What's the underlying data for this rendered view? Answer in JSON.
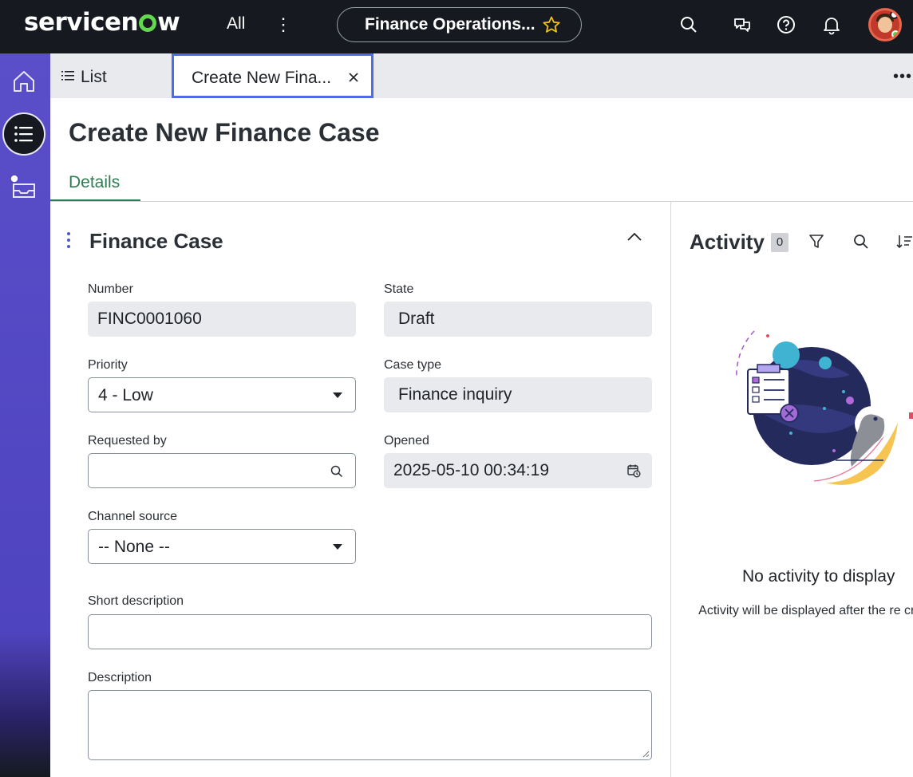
{
  "header": {
    "logo_text_a": "servicen",
    "logo_text_b": "w",
    "all_label": "All",
    "workspace_label": "Finance Operations...",
    "brand_color": "#62d84e"
  },
  "tabs": {
    "list_label": "List",
    "active_label": "Create New Fina..."
  },
  "page": {
    "title": "Create New Finance Case",
    "details_tab": "Details"
  },
  "form": {
    "section_title": "Finance Case",
    "number": {
      "label": "Number",
      "value": "FINC0001060"
    },
    "state": {
      "label": "State",
      "value": "Draft"
    },
    "priority": {
      "label": "Priority",
      "value": "4 - Low"
    },
    "case_type": {
      "label": "Case type",
      "value": "Finance inquiry"
    },
    "requested_by": {
      "label": "Requested by",
      "value": ""
    },
    "opened": {
      "label": "Opened",
      "value": "2025-05-10 00:34:19"
    },
    "channel_source": {
      "label": "Channel source",
      "value": "-- None --"
    },
    "short_description": {
      "label": "Short description",
      "value": ""
    },
    "description": {
      "label": "Description",
      "value": ""
    }
  },
  "activity": {
    "title": "Activity",
    "count": "0",
    "empty_title": "No activity to display",
    "empty_sub": "Activity will be displayed after the re created."
  },
  "colors": {
    "rail": "#5a4ec9",
    "header": "#161a20",
    "active_tab_border": "#4d6ce6",
    "details_accent": "#2e7d52"
  }
}
